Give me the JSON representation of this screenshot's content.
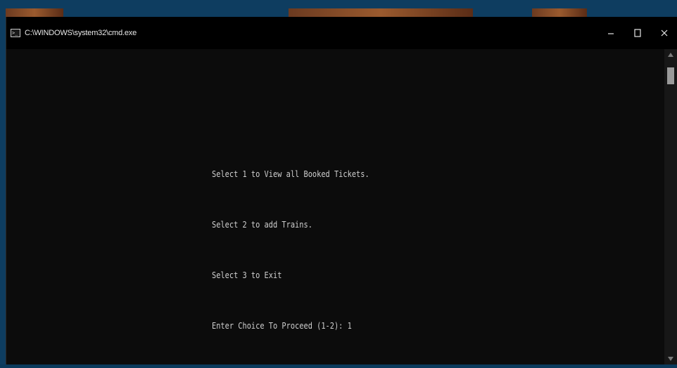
{
  "window": {
    "title": "C:\\WINDOWS\\system32\\cmd.exe",
    "icon": "cmd-icon",
    "controls": {
      "minimize": "–",
      "maximize": "☐",
      "close": "X"
    }
  },
  "console": {
    "lines": [
      "Select 1 to View all Booked Tickets.",
      "Select 2 to add Trains.",
      "Select 3 to Exit",
      "Enter Choice To Proceed (1-2): 1"
    ]
  },
  "colors": {
    "desktop": "#0e3d60",
    "titlebar": "#000000",
    "console_bg": "#0c0c0c",
    "console_text": "#cfcfcf"
  }
}
